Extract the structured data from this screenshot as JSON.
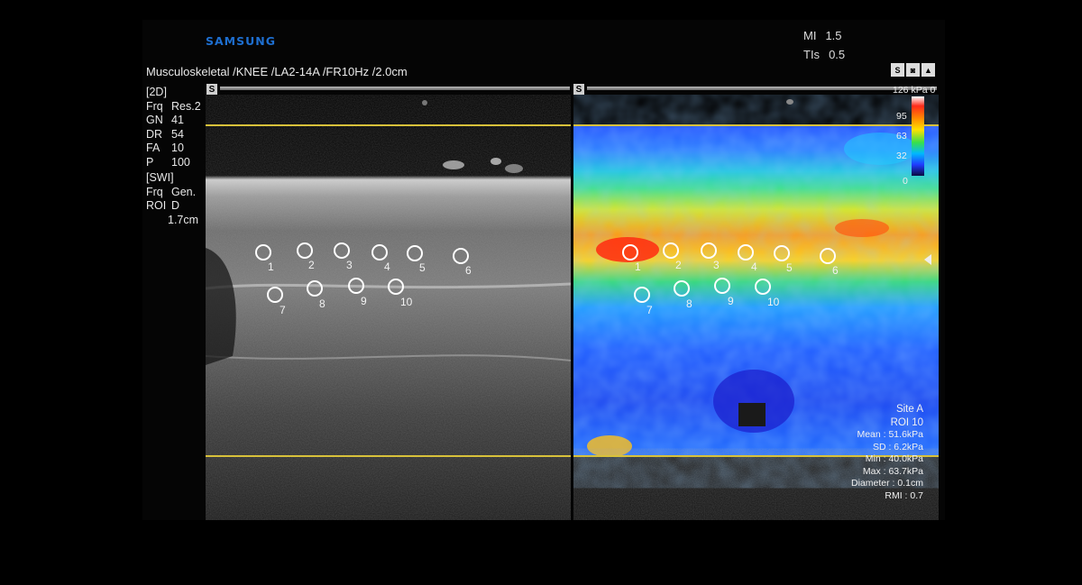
{
  "brand": "SAMSUNG",
  "safety": [
    {
      "label": "MI",
      "value": "1.5"
    },
    {
      "label": "TIs",
      "value": "0.5"
    }
  ],
  "header": "Musculoskeletal /KNEE /LA2-14A /FR10Hz /2.0cm",
  "mode_icons": [
    "S",
    "◙",
    "▲"
  ],
  "scale_markers": [
    "S",
    "S"
  ],
  "params_2d": {
    "title": "[2D]",
    "rows": [
      {
        "k": "Frq",
        "v": "Res.2"
      },
      {
        "k": "GN",
        "v": "41"
      },
      {
        "k": "DR",
        "v": "54"
      },
      {
        "k": "FA",
        "v": "10"
      },
      {
        "k": "P",
        "v": "100"
      }
    ]
  },
  "params_swi": {
    "title": "[SWI]",
    "rows": [
      {
        "k": "Frq",
        "v": "Gen."
      },
      {
        "k": "ROI",
        "v": "D"
      }
    ],
    "depth": "1.7cm"
  },
  "roi_labels_left": [
    "1",
    "2",
    "3",
    "4",
    "5",
    "6",
    "7",
    "8",
    "9",
    "10"
  ],
  "roi_labels_right": [
    "1",
    "2",
    "3",
    "4",
    "5",
    "6",
    "7",
    "8",
    "9",
    "10"
  ],
  "colorbar": {
    "max": "126",
    "unit": "kPa",
    "zero": "0",
    "ticks": [
      "95",
      "63",
      "32",
      "0"
    ],
    "colors": [
      "#ffffff",
      "#ff2a1a",
      "#ff8c00",
      "#ffe100",
      "#38e04a",
      "#00b8ff",
      "#1f3cff",
      "#0a0a40"
    ]
  },
  "measurement": {
    "site": "Site A",
    "roi": "ROI 10",
    "mean": "Mean : 51.6kPa",
    "sd": "SD : 6.2kPa",
    "min": "Min : 40.0kPa",
    "max": "Max : 63.7kPa",
    "diameter": "Diameter : 0.1cm",
    "rmi": "RMI : 0.7"
  },
  "accent_colors": {
    "brand": "#1e6fd0",
    "roi_box": "#d8c13a"
  }
}
